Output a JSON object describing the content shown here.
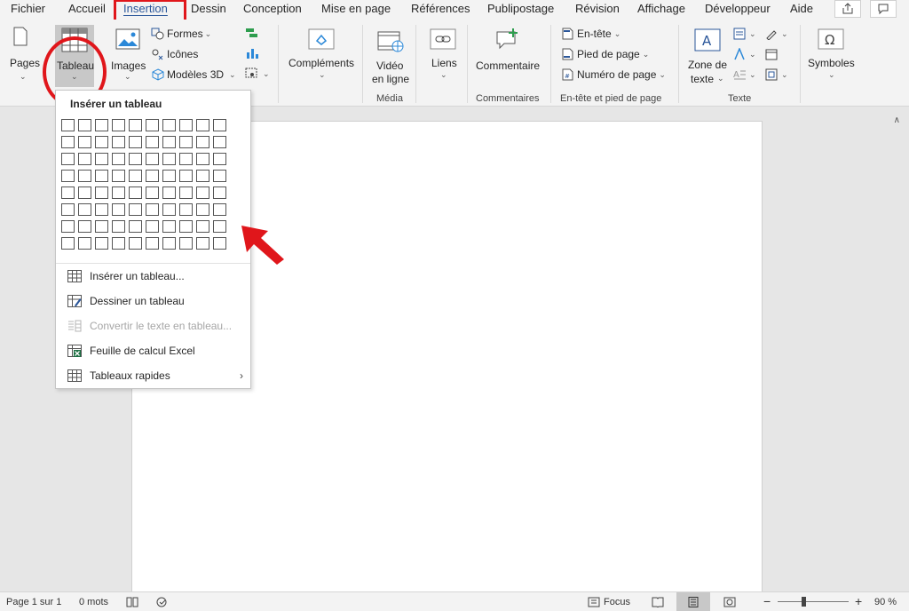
{
  "tabs": [
    {
      "label": "Fichier",
      "active": false
    },
    {
      "label": "Accueil",
      "active": false
    },
    {
      "label": "Insertion",
      "active": true
    },
    {
      "label": "Dessin",
      "active": false
    },
    {
      "label": "Conception",
      "active": false
    },
    {
      "label": "Mise en page",
      "active": false
    },
    {
      "label": "Références",
      "active": false
    },
    {
      "label": "Publipostage",
      "active": false
    },
    {
      "label": "Révision",
      "active": false
    },
    {
      "label": "Affichage",
      "active": false
    },
    {
      "label": "Développeur",
      "active": false
    },
    {
      "label": "Aide",
      "active": false
    }
  ],
  "ribbon": {
    "pages": "Pages",
    "tableau": "Tableau",
    "images": "Images",
    "formes": "Formes",
    "icones": "Icônes",
    "modeles3d": "Modèles 3D",
    "complements": "Compléments",
    "video_line1": "Vidéo",
    "video_line2": "en ligne",
    "liens": "Liens",
    "commentaire": "Commentaire",
    "entete": "En-tête",
    "pied": "Pied de page",
    "numero": "Numéro de page",
    "zone_line1": "Zone de",
    "zone_line2": "texte",
    "symboles": "Symboles",
    "groups": {
      "media": "Média",
      "commentaires": "Commentaires",
      "entete_pied": "En-tête et pied de page",
      "texte": "Texte"
    }
  },
  "dropdown": {
    "title": "Insérer un tableau",
    "grid_cols": 10,
    "grid_rows": 8,
    "items": [
      {
        "label": "Insérer un tableau...",
        "icon": "table-grid-icon",
        "disabled": false
      },
      {
        "label": "Dessiner un tableau",
        "icon": "draw-table-icon",
        "disabled": false
      },
      {
        "label": "Convertir le texte en tableau...",
        "icon": "convert-text-table-icon",
        "disabled": true
      },
      {
        "label": "Feuille de calcul Excel",
        "icon": "excel-sheet-icon",
        "disabled": false
      },
      {
        "label": "Tableaux rapides",
        "icon": "quick-tables-icon",
        "disabled": false,
        "submenu": true
      }
    ]
  },
  "status": {
    "page": "Page 1 sur 1",
    "words": "0 mots",
    "focus": "Focus",
    "zoom": "90 %"
  },
  "colors": {
    "accent": "#2b579a",
    "highlight_red": "#e0161b"
  }
}
